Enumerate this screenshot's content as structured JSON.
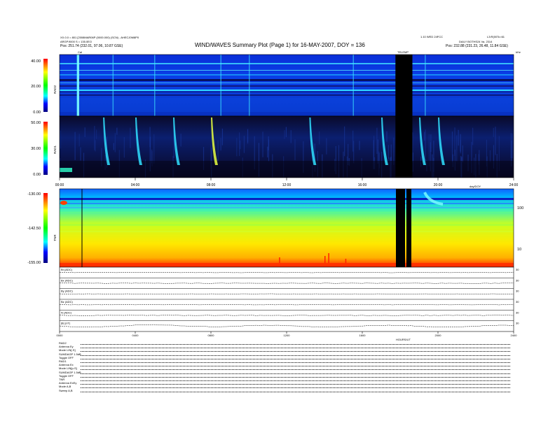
{
  "header": {
    "title": "WIND/WAVES Summary Plot (Page 1) for 16-MAY-2007, DOY = 136",
    "left_line1": "XX.0.0 = 801 [2008MAR06P (0000.000) (SCN) - AHECJ0M8P0",
    "left_line2": "ARGP.9000 S = 135.0EO",
    "left_line3": "Pos:    251.74 (232.01, 97.06, 10.87 GSE)",
    "right_line1": "1.10 WED 24FCC",
    "right_line2": "L3:R(00Tc=61",
    "right_line3": "DAILY  BOTHS24  Va.  2314",
    "right_line4": "Pos:    232.88 (231.23, 26.48, 11.84 GSE)",
    "cal_label": "Cal",
    "tele_label": "TELEMP",
    "khz_label": "kHz"
  },
  "panels": {
    "rad2": {
      "label": "RAD2",
      "ticks": [
        "40.00",
        "20.00",
        "0.00"
      ]
    },
    "rad1": {
      "label": "RAD1",
      "ticks": [
        "50.00",
        "30.00",
        "0.00"
      ]
    },
    "tnr": {
      "label": "TNR",
      "ticks": [
        "-130.00",
        "-142.50",
        "-155.00"
      ],
      "right_ticks": [
        "100",
        "10"
      ]
    }
  },
  "time_axis": {
    "ticks": [
      "00:00",
      "04:00",
      "08:00",
      "12:00",
      "16:00",
      "20:00",
      "24:00"
    ],
    "unit_label": "day/DOY"
  },
  "bottom_axis": {
    "ticks": [
      "0000",
      "0400",
      "0800",
      "1200",
      "1600",
      "2000",
      "2400"
    ],
    "unit_label": "HOURS/UT"
  },
  "bfield_rows": [
    {
      "label": "Bt (ADC)",
      "right": "30"
    },
    {
      "label": "Bx (ADC)",
      "right": "30"
    },
    {
      "label": "By (ADC)",
      "right": "30"
    },
    {
      "label": "Bz (ADC)",
      "right": "30"
    },
    {
      "label": "N (ADC)",
      "right": "30"
    },
    {
      "label": "|B| (nT)",
      "right": "30"
    }
  ],
  "footer_rows": [
    "RAD2",
    "Antenna     Ey",
    "Mode    LIN[-S]",
    "SUMDAGP  1.5dB",
    "Toggle    OFF",
    "RAD1",
    "Antenna     Ex",
    "Mode  LIN[p-S]",
    "SUMDAGP  1.5dB",
    "Toggle    OFF",
    "TNR",
    "Antenna   ExEy",
    "Mode       A,B",
    "Sweep      A,B"
  ],
  "chart_data": [
    {
      "type": "heatmap",
      "panel": "RAD2",
      "x": {
        "label": "",
        "range": [
          0,
          24
        ],
        "ticks": [
          "00:00",
          "04:00",
          "08:00",
          "12:00",
          "16:00",
          "20:00",
          "24:00"
        ]
      },
      "y": {
        "label": "RAD2",
        "range": [
          0,
          40
        ],
        "ticks": [
          40,
          20,
          0
        ]
      },
      "bursts_hours": [
        0.9,
        2.8,
        5.0,
        8.5,
        10.0,
        15.5,
        19.3
      ],
      "data_gap_hours": [
        17.9,
        18.5
      ],
      "colormap": [
        "#000060",
        "#0000ff",
        "#00ffff",
        "#00ff00",
        "#ffff00",
        "#ff0000"
      ]
    },
    {
      "type": "heatmap",
      "panel": "RAD1",
      "x": {
        "label": "",
        "range": [
          0,
          24
        ],
        "ticks": [
          "00:00",
          "04:00",
          "08:00",
          "12:00",
          "16:00",
          "20:00",
          "24:00"
        ]
      },
      "y": {
        "label": "RAD1",
        "range": [
          0,
          50
        ],
        "ticks": [
          50,
          30,
          0
        ]
      },
      "bursts_hours": [
        2.3,
        4.0,
        6.0,
        8.0,
        13.2,
        17.0,
        19.0,
        20.0
      ],
      "data_gap_hours": [
        17.9,
        18.5
      ]
    },
    {
      "type": "heatmap",
      "panel": "TNR",
      "x": {
        "label": "",
        "range": [
          0,
          24
        ],
        "ticks": [
          "00:00",
          "04:00",
          "08:00",
          "12:00",
          "16:00",
          "20:00",
          "24:00"
        ]
      },
      "y": {
        "label": "TNR",
        "range": [
          -155,
          -130
        ],
        "ticks": [
          -130,
          -142.5,
          -155
        ]
      },
      "data_gap_hours": [
        17.9,
        18.5
      ],
      "cal_hour": 1.1
    },
    {
      "type": "line",
      "panel": "magnetometer",
      "x": {
        "label": "HOURS/UT",
        "range": [
          0,
          24
        ],
        "ticks": [
          "0000",
          "0400",
          "0800",
          "1200",
          "1600",
          "2000",
          "2400"
        ]
      },
      "series": [
        {
          "name": "Bt (ADC)",
          "values": [
            0.5,
            0.5,
            0.5,
            0.5,
            0.5,
            0.5,
            0.5
          ]
        },
        {
          "name": "Bx (ADC)",
          "values": [
            0.5,
            0.5,
            0.5,
            0.5,
            0.5,
            0.5,
            0.5
          ]
        },
        {
          "name": "By (ADC)",
          "values": [
            0.5,
            0.5,
            0.5,
            0.5,
            0.5,
            0.5,
            0.5
          ]
        },
        {
          "name": "Bz (ADC)",
          "values": [
            0.5,
            0.5,
            0.5,
            0.5,
            0.5,
            0.5,
            0.5
          ]
        },
        {
          "name": "N (ADC)",
          "values": [
            0.5,
            0.5,
            0.5,
            0.5,
            0.5,
            0.5,
            0.5
          ]
        },
        {
          "name": "|B| (nT)",
          "values": [
            0.5,
            0.55,
            0.5,
            0.5,
            0.5,
            0.5,
            0.5
          ]
        }
      ]
    }
  ]
}
